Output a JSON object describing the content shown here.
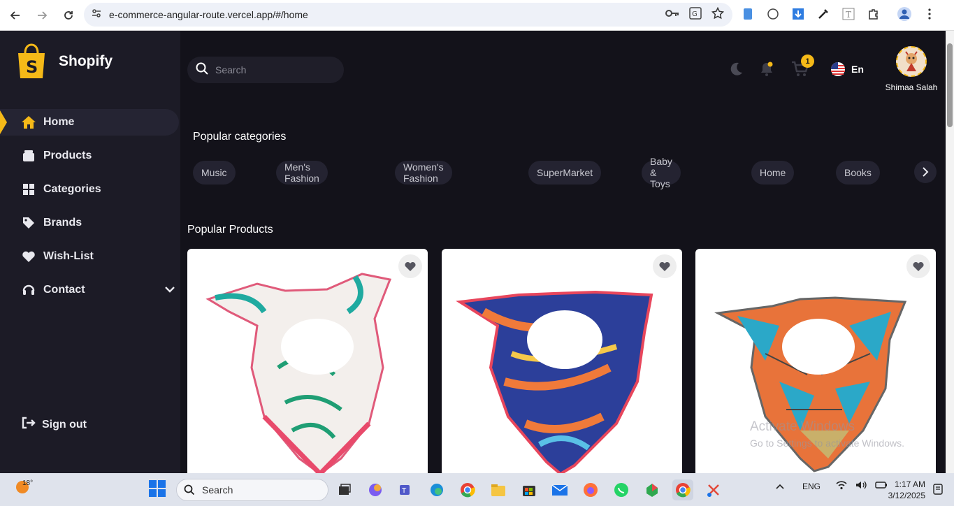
{
  "browser": {
    "url": "e-commerce-angular-route.vercel.app/#/home"
  },
  "sidebar": {
    "brand": "Shopify",
    "items": [
      {
        "label": "Home",
        "icon": "home-icon",
        "active": true
      },
      {
        "label": "Products",
        "icon": "box-icon"
      },
      {
        "label": "Categories",
        "icon": "grid-icon"
      },
      {
        "label": "Brands",
        "icon": "tag-icon"
      },
      {
        "label": "Wish-List",
        "icon": "heart-icon"
      },
      {
        "label": "Contact",
        "icon": "headset-icon",
        "has_dropdown": true
      }
    ],
    "signout": "Sign out"
  },
  "header": {
    "search_placeholder": "Search",
    "cart_count": "1",
    "language": "En",
    "user_name": "Shimaa Salah"
  },
  "categories": {
    "title": "Popular categories",
    "items": [
      "Music",
      "Men's Fashion",
      "Women's Fashion",
      "SuperMarket",
      "Baby & Toys",
      "Home",
      "Books"
    ]
  },
  "products": {
    "title": "Popular Products"
  },
  "overlay": {
    "activate_title": "Activate Windows",
    "activate_sub": "Go to Settings to activate Windows."
  },
  "taskbar": {
    "temperature": "18°",
    "search_label": "Search",
    "language": "ENG",
    "time": "1:17 AM",
    "date": "3/12/2025"
  },
  "colors": {
    "accent": "#f5b918",
    "background": "#13121a",
    "sidebar": "#1c1b26"
  }
}
